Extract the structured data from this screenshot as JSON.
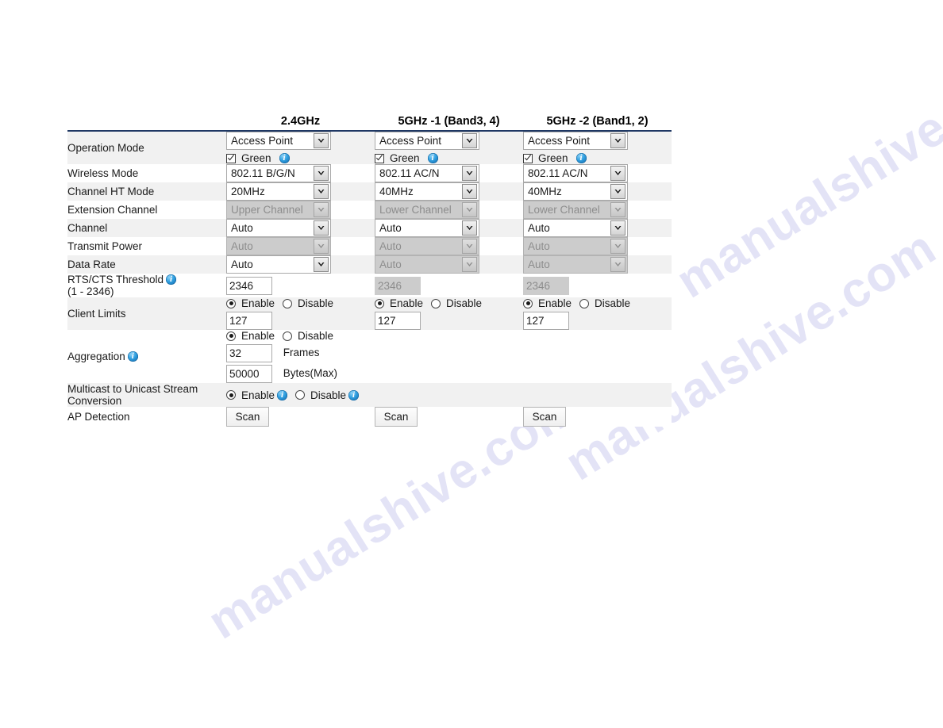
{
  "watermark": {
    "text_a": "manualshive.com",
    "text_b": "manualshive.com",
    "text_c": "manualshive.com",
    "color": "#cdcdf0"
  },
  "table": {
    "header": {
      "label_col": "",
      "bands": [
        "2.4GHz",
        "5GHz -1 (Band3, 4)",
        "5GHz -2 (Band1, 2)"
      ]
    },
    "rows": [
      {
        "label": "Operation Mode",
        "cells": [
          {
            "select": "Access Point",
            "checkbox_label": "Green"
          },
          {
            "select": "Access Point",
            "checkbox_label": "Green"
          },
          {
            "select": "Access Point",
            "checkbox_label": "Green"
          }
        ]
      },
      {
        "label": "Wireless Mode",
        "cells": [
          {
            "select": "802.11 B/G/N"
          },
          {
            "select": "802.11 AC/N"
          },
          {
            "select": "802.11 AC/N"
          }
        ]
      },
      {
        "label": "Channel HT Mode",
        "cells": [
          {
            "select": "20MHz"
          },
          {
            "select": "40MHz"
          },
          {
            "select": "40MHz"
          }
        ]
      },
      {
        "label": "Extension Channel",
        "cells": [
          {
            "select": "Upper Channel",
            "disabled": true
          },
          {
            "select": "Lower Channel",
            "disabled": true
          },
          {
            "select": "Lower Channel",
            "disabled": true
          }
        ]
      },
      {
        "label": "Channel",
        "cells": [
          {
            "select": "Auto"
          },
          {
            "select": "Auto"
          },
          {
            "select": "Auto"
          }
        ]
      },
      {
        "label": "Transmit Power",
        "cells": [
          {
            "select": "Auto",
            "disabled": true
          },
          {
            "select": "Auto",
            "disabled": true
          },
          {
            "select": "Auto",
            "disabled": true
          }
        ]
      },
      {
        "label": "Data Rate",
        "cells": [
          {
            "select": "Auto"
          },
          {
            "select": "Auto",
            "disabled": true
          },
          {
            "select": "Auto",
            "disabled": true
          }
        ]
      },
      {
        "label": "RTS/CTS Threshold",
        "label_line2": "(1 - 2346)",
        "has_info": true,
        "cells": [
          {
            "text": "2346"
          },
          {
            "text": "2346",
            "disabled": true
          },
          {
            "text": "2346",
            "disabled": true
          }
        ]
      },
      {
        "label": "Client Limits",
        "cells": [
          {
            "radio_on": "Enable",
            "radio_off": "Disable",
            "selected": "Enable",
            "text": "127"
          },
          {
            "radio_on": "Enable",
            "radio_off": "Disable",
            "selected": "Enable",
            "text": "127"
          },
          {
            "radio_on": "Enable",
            "radio_off": "Disable",
            "selected": "Enable",
            "text": "127"
          }
        ]
      },
      {
        "label": "Aggregation",
        "has_info": true,
        "cells": [
          {
            "radio_on": "Enable",
            "radio_off": "Disable",
            "selected": "Enable",
            "frames_value": "32",
            "frames_unit": "Frames",
            "bytes_value": "50000",
            "bytes_unit": "Bytes(Max)"
          }
        ]
      },
      {
        "label": "Multicast to Unicast Stream",
        "label_line2": "Conversion",
        "cells": [
          {
            "radio_on": "Enable",
            "radio_off": "Disable",
            "selected": "Enable",
            "info_on_enable": true,
            "info_on_disable": true
          }
        ]
      },
      {
        "label": "AP Detection",
        "cells": [
          {
            "button": "Scan"
          },
          {
            "button": "Scan"
          },
          {
            "button": "Scan"
          }
        ]
      }
    ]
  },
  "colors": {
    "header_rule": "#1f3864",
    "row_alt": "#f1f1f1",
    "row_norm": "#ffffff",
    "info_icon": "#2f9fe0",
    "disabled_bg": "#cccccc",
    "disabled_text": "#8d8d8d"
  }
}
